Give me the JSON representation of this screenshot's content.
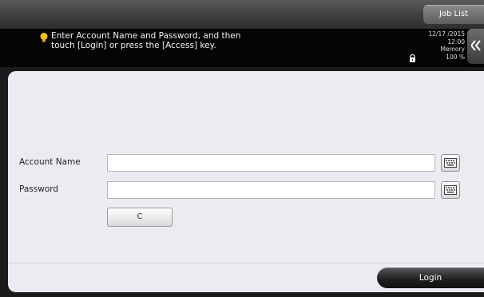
{
  "header": {
    "job_list_label": "Job List",
    "message_line1": "Enter Account Name and Password, and then",
    "message_line2": "touch [Login] or press the [Access] key.",
    "date": "12/17 /2015",
    "time": "12:00",
    "memory_label": "Memory",
    "memory_value": "100 %"
  },
  "form": {
    "account_name_label": "Account Name",
    "account_name_value": "",
    "password_label": "Password",
    "password_value": "",
    "clear_label": "C",
    "login_label": "Login"
  },
  "icons": {
    "message": "lightbulb-icon",
    "lock": "lock-icon",
    "back": "back-arrow-icon",
    "keyboard": "keyboard-icon"
  }
}
